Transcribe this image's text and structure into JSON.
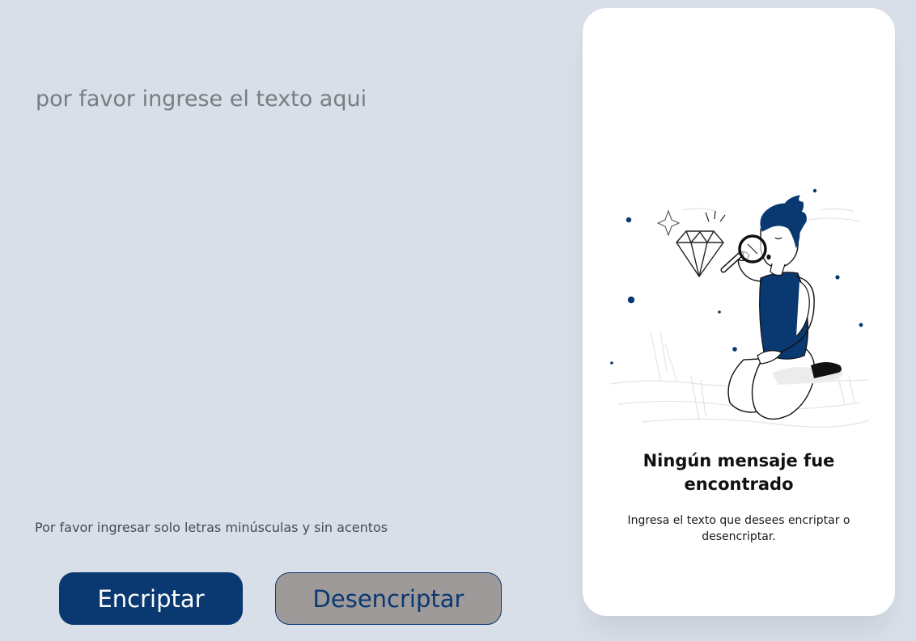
{
  "input": {
    "placeholder": "por favor ingrese el texto aqui",
    "value": ""
  },
  "hint": {
    "text": "Por favor ingresar solo letras minúsculas y sin acentos"
  },
  "buttons": {
    "encrypt_label": "Encriptar",
    "decrypt_label": "Desencriptar"
  },
  "output_panel": {
    "title": "Ningún mensaje fue encontrado",
    "subtitle": "Ingresa el texto que desees encriptar o desencriptar.",
    "illustration_icon": "person-with-magnifier-illustration"
  },
  "colors": {
    "background": "#d8dfe8",
    "primary": "#0a3871",
    "secondary_button": "#9e9a9a",
    "card": "#ffffff"
  }
}
